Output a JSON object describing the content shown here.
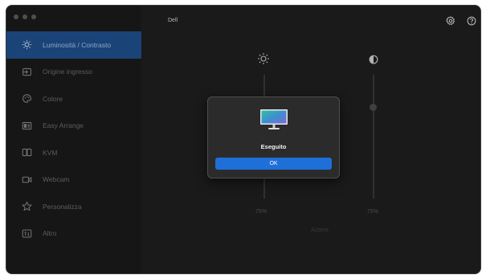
{
  "app": {
    "title": "Dell"
  },
  "sidebar": {
    "items": [
      {
        "label": "Luminosità / Contrasto",
        "icon": "brightness-icon",
        "active": true
      },
      {
        "label": "Origine ingresso",
        "icon": "input-source-icon",
        "active": false
      },
      {
        "label": "Colore",
        "icon": "palette-icon",
        "active": false
      },
      {
        "label": "Easy Arrange",
        "icon": "layout-icon",
        "active": false
      },
      {
        "label": "KVM",
        "icon": "kvm-icon",
        "active": false
      },
      {
        "label": "Webcam",
        "icon": "webcam-icon",
        "active": false
      },
      {
        "label": "Personalizza",
        "icon": "star-icon",
        "active": false
      },
      {
        "label": "Altro",
        "icon": "more-icon",
        "active": false
      }
    ]
  },
  "brightness": {
    "value_label": "75%",
    "value": 75
  },
  "contrast": {
    "value_label": "75%",
    "value": 75
  },
  "reset_label": "Azzera",
  "dialog": {
    "message": "Eseguito",
    "ok_label": "OK"
  },
  "colors": {
    "accent": "#1f6fd8",
    "active_item": "#1f4f8d",
    "background": "#1f1f1f"
  }
}
